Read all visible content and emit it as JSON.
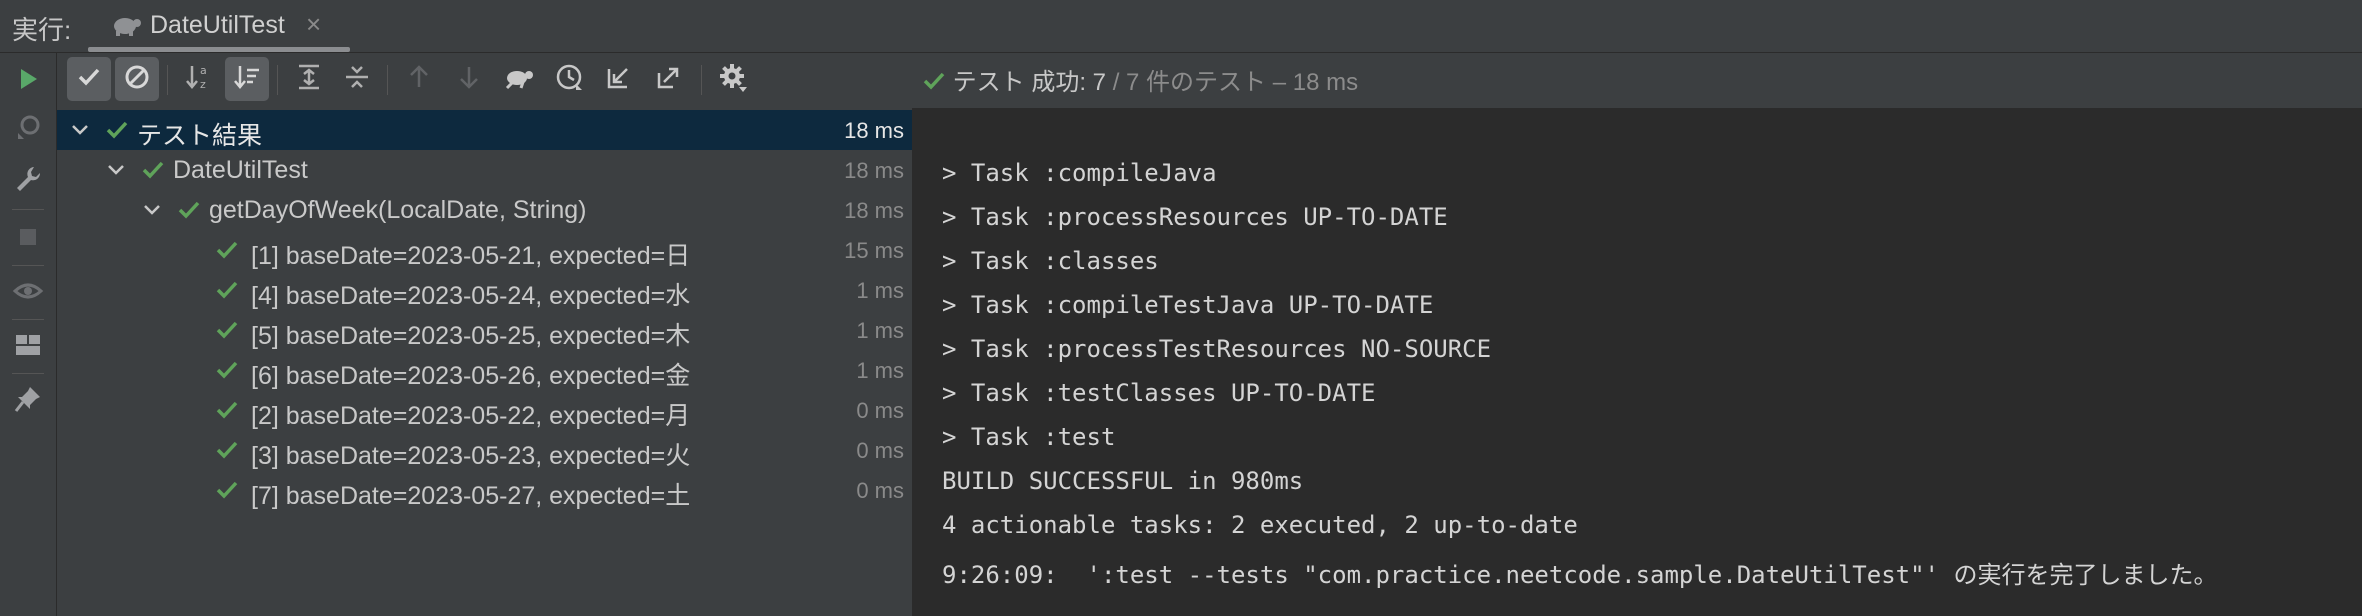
{
  "run_bar": {
    "label": "実行:",
    "tab_title": "DateUtilTest",
    "tab_close": "×"
  },
  "status": {
    "summary": "テスト 成功: 7",
    "detail": " / 7 件のテスト – 18 ms"
  },
  "colors": {
    "pass": "#5fa35a",
    "run": "#59a869",
    "selection": "#0d293e",
    "console_bg": "#2b2b2b"
  },
  "left_toolbar": [
    "run-icon",
    "rerun-failed-icon",
    "wrench-icon",
    "stop-icon",
    "eye-icon",
    "layout-icon",
    "pin-icon"
  ],
  "test_toolbar": [
    "show-passed-icon",
    "show-ignored-icon",
    "sort-alpha-icon",
    "sort-duration-icon",
    "expand-all-icon",
    "collapse-all-icon",
    "prev-failed-icon",
    "next-failed-icon",
    "turtle-icon",
    "history-icon",
    "import-icon",
    "export-icon",
    "settings-icon"
  ],
  "tree": [
    {
      "label": "テスト結果",
      "duration": "18 ms",
      "level": 0
    },
    {
      "label": "DateUtilTest",
      "duration": "18 ms",
      "level": 1
    },
    {
      "label": "getDayOfWeek(LocalDate, String)",
      "duration": "18 ms",
      "level": 2
    },
    {
      "label": "[1] baseDate=2023-05-21, expected=日",
      "duration": "15 ms",
      "level": 3
    },
    {
      "label": "[4] baseDate=2023-05-24, expected=水",
      "duration": "1 ms",
      "level": 3
    },
    {
      "label": "[5] baseDate=2023-05-25, expected=木",
      "duration": "1 ms",
      "level": 3
    },
    {
      "label": "[6] baseDate=2023-05-26, expected=金",
      "duration": "1 ms",
      "level": 3
    },
    {
      "label": "[2] baseDate=2023-05-22, expected=月",
      "duration": "0 ms",
      "level": 3
    },
    {
      "label": "[3] baseDate=2023-05-23, expected=火",
      "duration": "0 ms",
      "level": 3
    },
    {
      "label": "[7] baseDate=2023-05-27, expected=土",
      "duration": "0 ms",
      "level": 3
    }
  ],
  "console": [
    "> Task :compileJava",
    "> Task :processResources UP-TO-DATE",
    "> Task :classes",
    "> Task :compileTestJava UP-TO-DATE",
    "> Task :processTestResources NO-SOURCE",
    "> Task :testClasses UP-TO-DATE",
    "> Task :test",
    "BUILD SUCCESSFUL in 980ms",
    "4 actionable tasks: 2 executed, 2 up-to-date",
    "9:26:09:  ':test --tests \"com.practice.neetcode.sample.DateUtilTest\"' の実行を完了しました。"
  ]
}
